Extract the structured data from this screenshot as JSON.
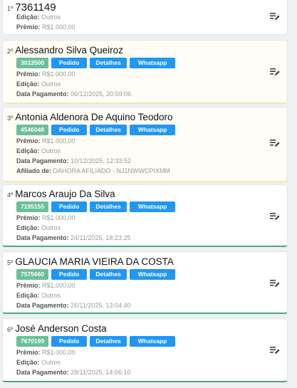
{
  "labels": {
    "premio": "Prêmio:",
    "edicao": "Edição:",
    "data_pagamento": "Data Pagamento:",
    "afiliado": "Afiliado de:",
    "pedido_button": "Pedido",
    "detalhes_button": "Detalhes",
    "whatsapp_button": "Whatsapp"
  },
  "cards": [
    {
      "rank": "1º",
      "name": "7361149",
      "edicao": "Outros",
      "premio": "R$1.000,00"
    },
    {
      "rank": "2º",
      "name": "Alessandro Silva Queiroz",
      "code": "3013500",
      "premio": "R$1.000,00",
      "edicao": "Outros",
      "data_pagamento": "06/12/2025, 20:59:06"
    },
    {
      "rank": "3º",
      "name": "Antonia Aldenora De Aquino Teodoro",
      "code": "4546048",
      "premio": "R$1.000,00",
      "edicao": "Outros",
      "data_pagamento": "10/12/2025, 12:33:52",
      "afiliado": "DAHORA AFILIADO - NJ1NWWCPIXMM"
    },
    {
      "rank": "4º",
      "name": "Marcos Araujo Da Silva",
      "code": "7195155",
      "premio": "R$1.000,00",
      "edicao": "Outros",
      "data_pagamento": "24/11/2025, 18:23:25"
    },
    {
      "rank": "5º",
      "name": "GLAUCIA MARIA VIEIRA DA COSTA",
      "code": "7575660",
      "premio": "R$1.000,00",
      "edicao": "Outros",
      "data_pagamento": "26/11/2025, 13:04:40"
    },
    {
      "rank": "6º",
      "name": "José Anderson Costa",
      "code": "7670199",
      "premio": "R$1.000,00",
      "edicao": "Outros",
      "data_pagamento": "28/11/2025, 14:06:10"
    }
  ],
  "icons": {
    "edit": "edit-list-icon"
  },
  "colors": {
    "code_badge": "#6bbf9a",
    "button": "#2196f3",
    "green_border": "#4fa77a",
    "yellow_border": "#f1e7b8"
  }
}
